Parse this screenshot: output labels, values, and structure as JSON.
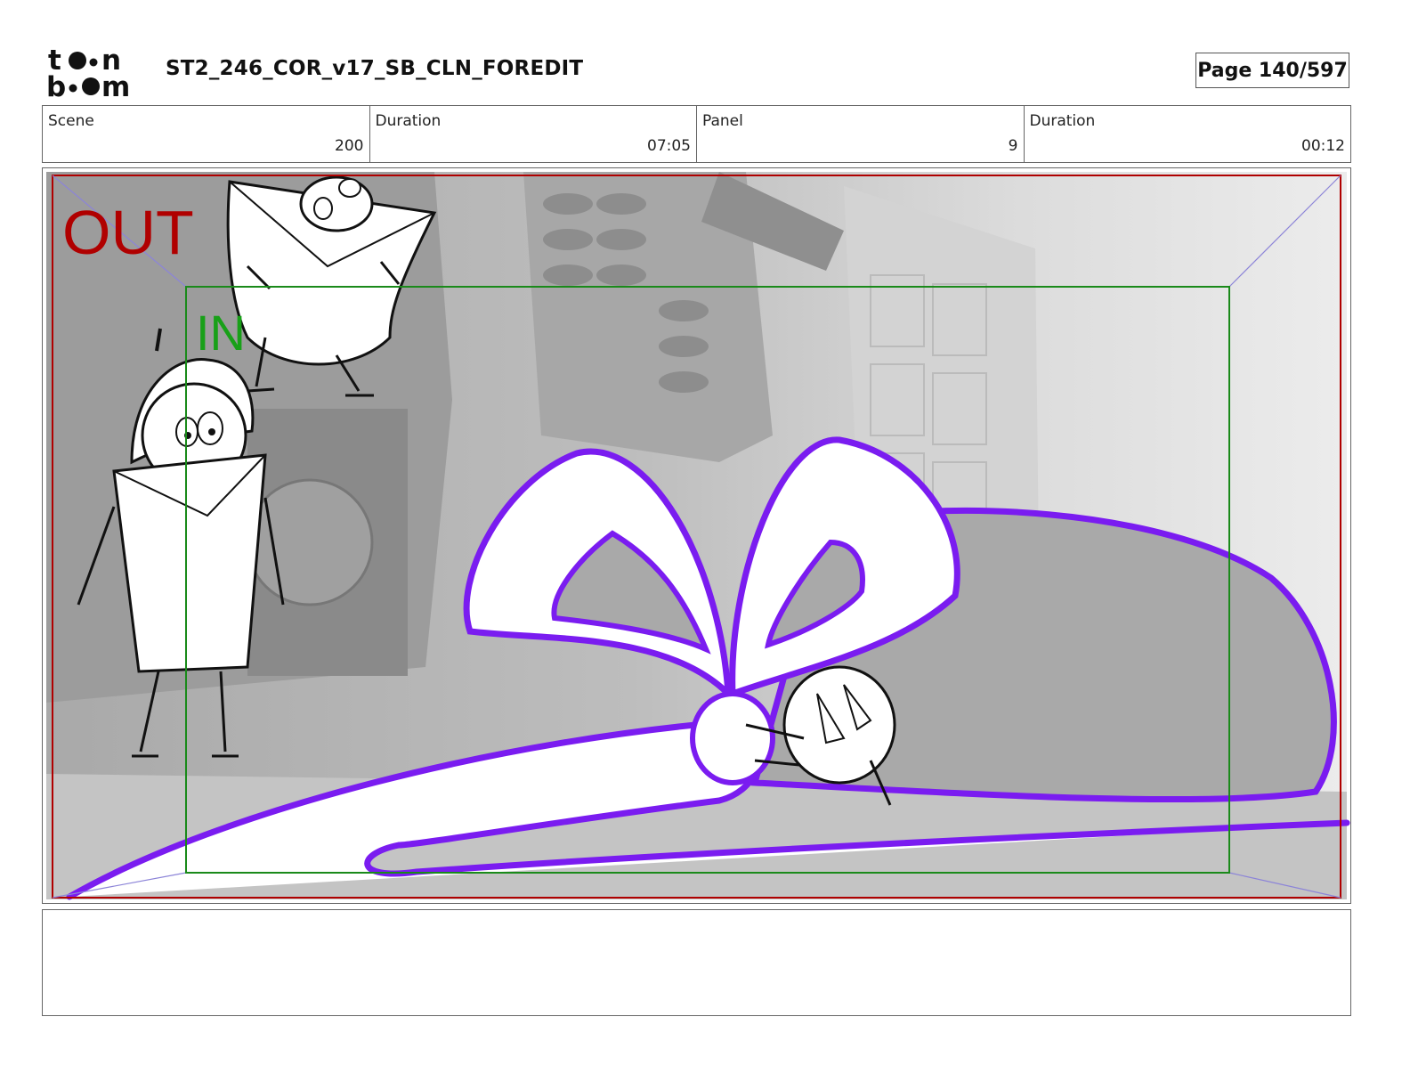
{
  "header": {
    "logo_text": "toon boom",
    "title": "ST2_246_COR_v17_SB_CLN_FOREDIT",
    "page": "Page 140/597"
  },
  "info": {
    "scene_label": "Scene",
    "scene_value": "200",
    "scene_duration_label": "Duration",
    "scene_duration_value": "07:05",
    "panel_label": "Panel",
    "panel_value": "9",
    "panel_duration_label": "Duration",
    "panel_duration_value": "00:12"
  },
  "panel": {
    "out_label": "OUT",
    "in_label": "IN",
    "colors": {
      "out_frame": "#b00000",
      "in_frame": "#1a8a1a",
      "ribbon": "#7a1cf0",
      "background": "#cfcfcf"
    }
  },
  "notes": {
    "text": ""
  }
}
